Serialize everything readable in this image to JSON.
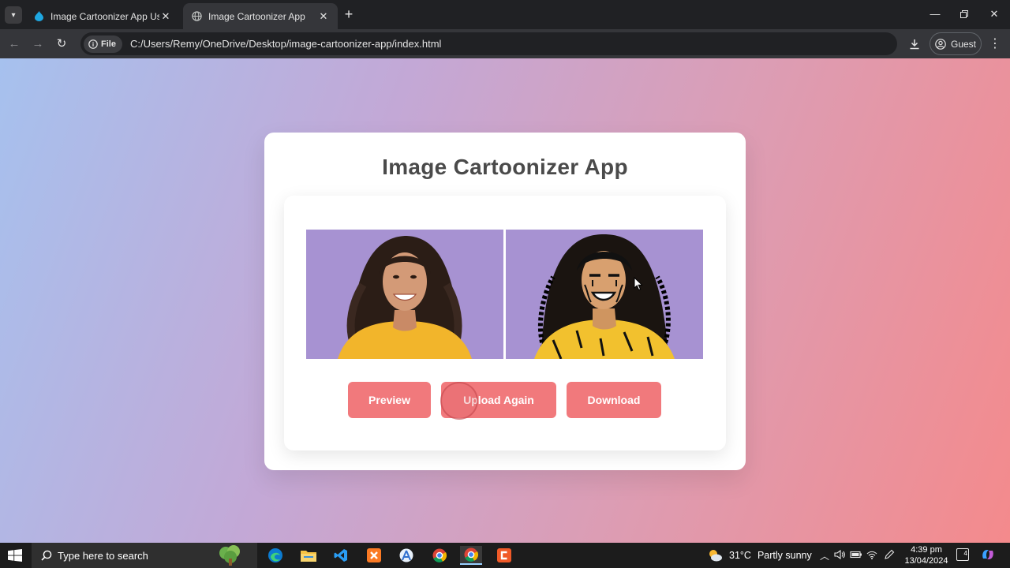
{
  "browser": {
    "tabs": [
      {
        "title": "Image Cartoonizer App Using H",
        "active": false,
        "icon": "drupal-drop-icon"
      },
      {
        "title": "Image Cartoonizer App",
        "active": true,
        "icon": "globe-icon"
      }
    ],
    "new_tab_symbol": "+",
    "address": {
      "chip_label": "File",
      "url": "C:/Users/Remy/OneDrive/Desktop/image-cartoonizer-app/index.html"
    },
    "profile_label": "Guest"
  },
  "page": {
    "title": "Image Cartoonizer App",
    "images": {
      "original": "original-photo",
      "cartoon": "cartoonized-photo"
    },
    "buttons": {
      "preview": "Preview",
      "upload": "Upload Again",
      "download": "Download"
    },
    "colors": {
      "button": "#f1797c",
      "gradient_start": "#a6c1ee",
      "gradient_end": "#f48a8c"
    }
  },
  "taskbar": {
    "search_placeholder": "Type here to search",
    "weather": {
      "temp": "31°C",
      "condition": "Partly sunny"
    },
    "clock": {
      "time": "4:39 pm",
      "date": "13/04/2024"
    },
    "notification_count": "4"
  }
}
